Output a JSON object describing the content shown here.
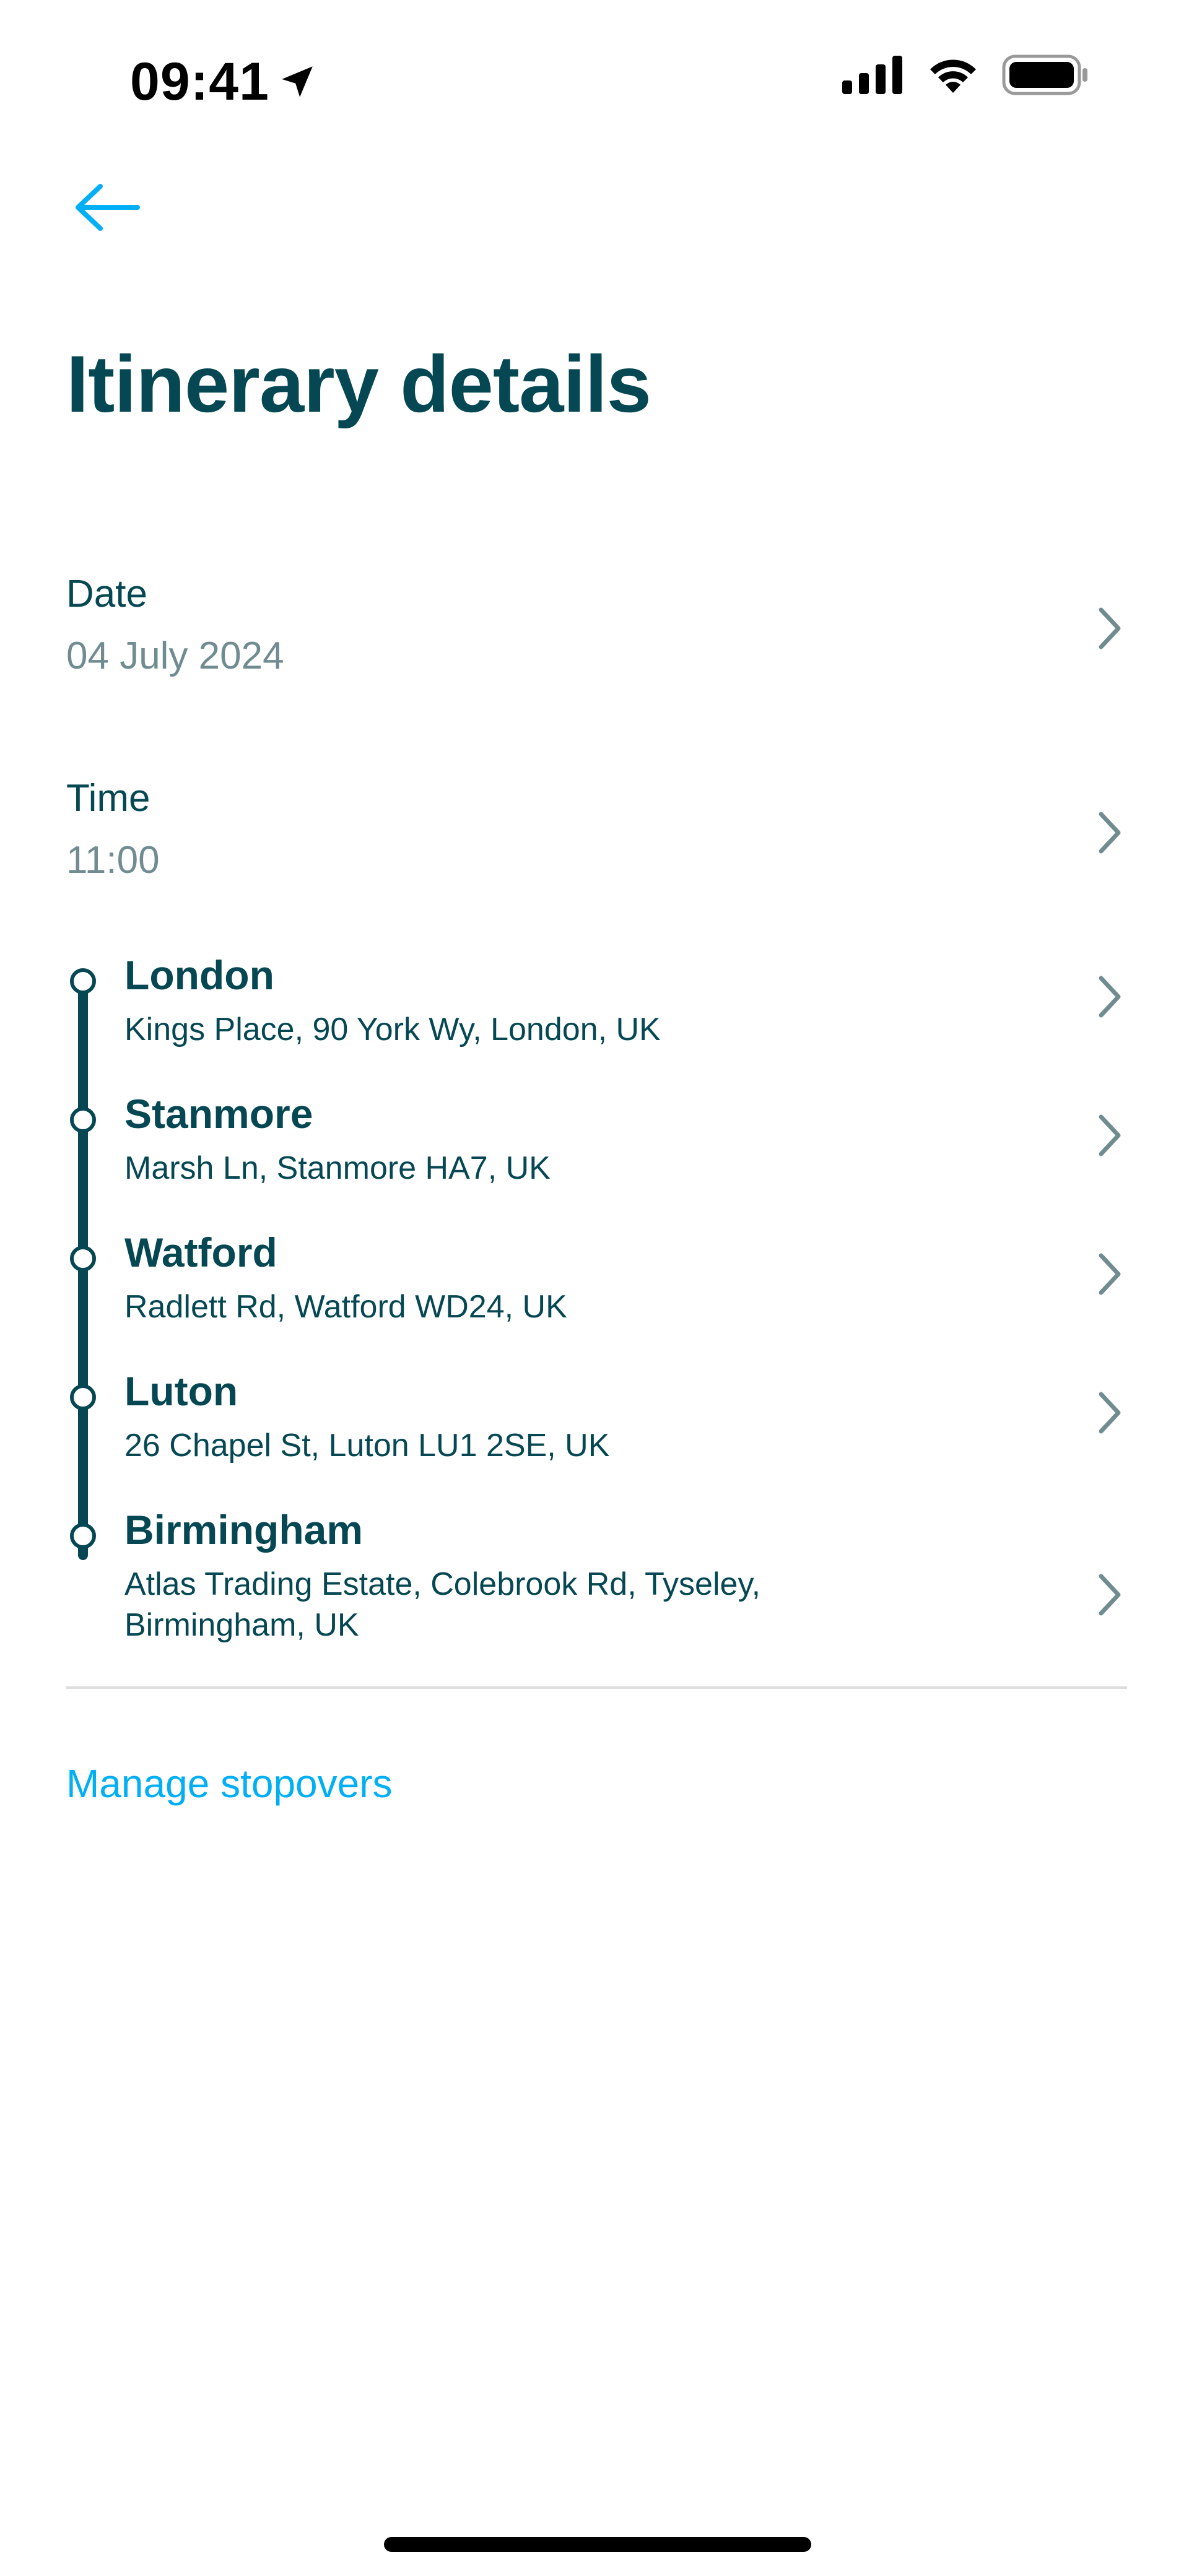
{
  "status_bar": {
    "time": "09:41"
  },
  "header": {
    "title": "Itinerary details"
  },
  "fields": {
    "date": {
      "label": "Date",
      "value": "04 July 2024"
    },
    "time": {
      "label": "Time",
      "value": "11:00"
    }
  },
  "itinerary": {
    "stops": [
      {
        "name": "London",
        "address": "Kings Place, 90 York Wy, London, UK"
      },
      {
        "name": "Stanmore",
        "address": "Marsh Ln, Stanmore HA7, UK"
      },
      {
        "name": "Watford",
        "address": "Radlett Rd, Watford WD24, UK"
      },
      {
        "name": "Luton",
        "address": "26 Chapel St, Luton LU1 2SE, UK"
      },
      {
        "name": "Birmingham",
        "address": "Atlas Trading Estate, Colebrook Rd, Tyseley, Birmingham, UK"
      }
    ]
  },
  "actions": {
    "manage_stopovers": "Manage stopovers"
  },
  "icons": {
    "back": "arrow-left-icon",
    "chevron": "chevron-right-icon",
    "location": "location-arrow-icon",
    "signal": "cellular-signal-icon",
    "wifi": "wifi-icon",
    "battery": "battery-icon"
  },
  "colors": {
    "primary_text": "#054752",
    "secondary_text": "#708c91",
    "accent": "#00aff5",
    "divider": "#dddddd"
  }
}
